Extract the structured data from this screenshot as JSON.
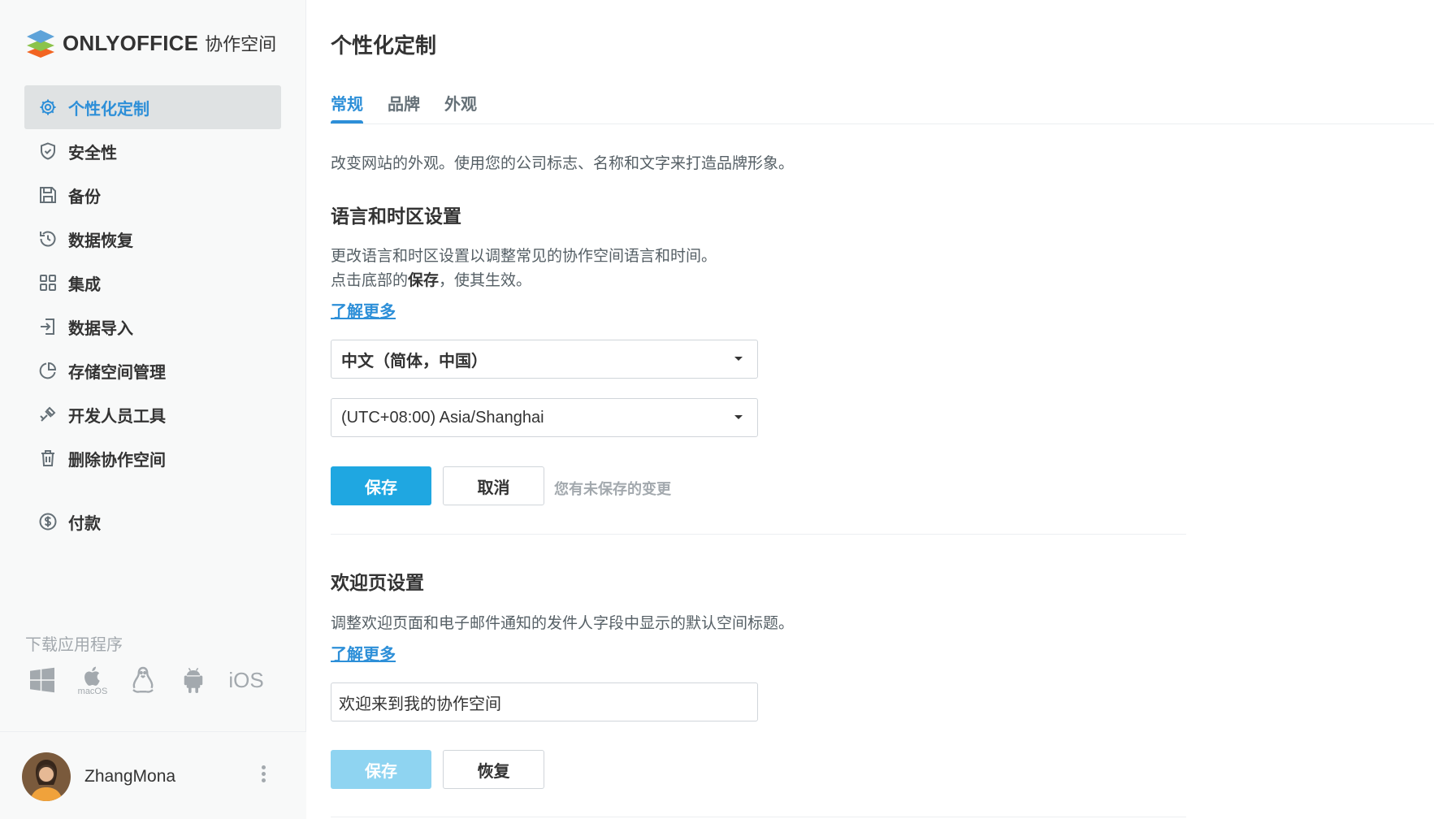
{
  "brand": {
    "name": "ONLYOFFICE",
    "subtitle": "协作空间",
    "colors": {
      "accent": "#2d8fd8",
      "primary_button": "#1fa7e1",
      "logo_top": "#5ea3d9",
      "logo_mid": "#8bc34a",
      "logo_bottom": "#f26522"
    }
  },
  "sidebar": {
    "items": [
      {
        "label": "个性化定制",
        "icon": "gear-icon",
        "active": true
      },
      {
        "label": "安全性",
        "icon": "shield-icon"
      },
      {
        "label": "备份",
        "icon": "save-icon"
      },
      {
        "label": "数据恢复",
        "icon": "history-icon"
      },
      {
        "label": "集成",
        "icon": "grid-icon"
      },
      {
        "label": "数据导入",
        "icon": "import-icon"
      },
      {
        "label": "存储空间管理",
        "icon": "pie-chart-icon"
      },
      {
        "label": "开发人员工具",
        "icon": "developer-tools-icon"
      },
      {
        "label": "删除协作空间",
        "icon": "trash-icon"
      },
      {
        "label": "付款",
        "icon": "dollar-icon"
      }
    ],
    "download_title": "下载应用程序",
    "apps": [
      {
        "name": "windows",
        "icon": "windows-icon"
      },
      {
        "name": "macos",
        "icon": "apple-icon",
        "label": "macOS"
      },
      {
        "name": "linux",
        "icon": "linux-icon"
      },
      {
        "name": "android",
        "icon": "android-icon"
      },
      {
        "name": "ios",
        "icon": "ios-icon",
        "label": "iOS"
      }
    ]
  },
  "profile": {
    "username": "ZhangMona",
    "menu_icon": "more-vertical-icon"
  },
  "main": {
    "title": "个性化定制",
    "tabs": [
      {
        "label": "常规",
        "active": true
      },
      {
        "label": "品牌"
      },
      {
        "label": "外观"
      }
    ],
    "intro": "改变网站的外观。使用您的公司标志、名称和文字来打造品牌形象。",
    "language_section": {
      "title": "语言和时区设置",
      "desc_line1": "更改语言和时区设置以调整常见的协作空间语言和时间。",
      "desc_line2_pre": "点击底部的",
      "desc_line2_bold": "保存",
      "desc_line2_post": "，使其生效。",
      "learn_more": "了解更多",
      "language_value": "中文（简体，中国）",
      "timezone_value": "(UTC+08:00) Asia/Shanghai",
      "save_label": "保存",
      "cancel_label": "取消",
      "unsaved_text": "您有未保存的变更"
    },
    "welcome_section": {
      "title": "欢迎页设置",
      "desc": "调整欢迎页面和电子邮件通知的发件人字段中显示的默认空间标题。",
      "learn_more": "了解更多",
      "input_value": "欢迎来到我的协作空间",
      "save_label": "保存",
      "restore_label": "恢复"
    }
  }
}
